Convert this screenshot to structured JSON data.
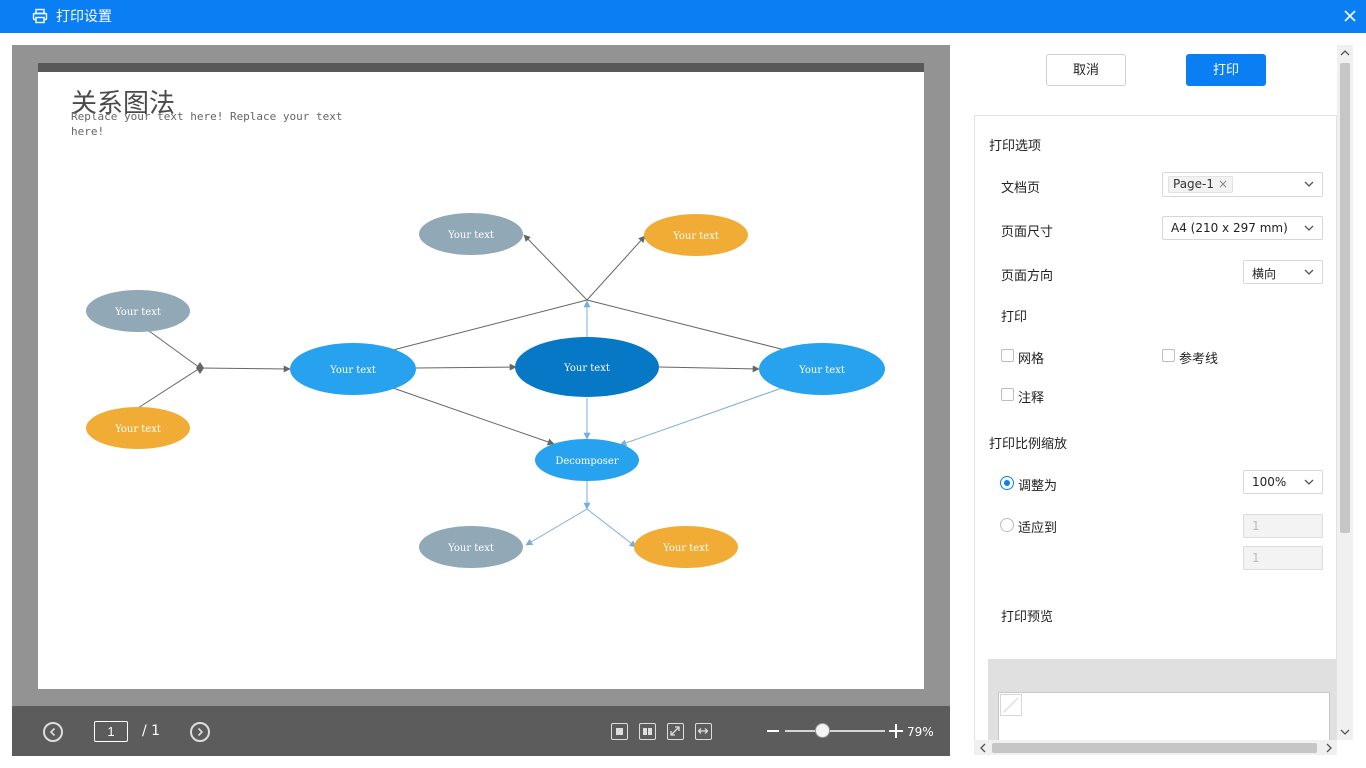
{
  "titlebar": {
    "title": "打印设置",
    "icon": "printer-icon",
    "close_icon": "close-icon",
    "color": "#0a7ff3"
  },
  "document": {
    "title": "关系图法",
    "subtitle": "Replace your text here!  Replace your text here!",
    "nodes": {
      "top_left": "Your text",
      "top_right": "Your text",
      "left_top": "Your text",
      "left_bottom": "Your text",
      "mid_left": "Your text",
      "center": "Your text",
      "mid_right": "Your text",
      "decomposer": "Decomposer",
      "bottom_left": "Your text",
      "bottom_right": "Your text"
    },
    "colors": {
      "gray": "#91a8b7",
      "orange": "#f0ac35",
      "blue": "#27a2ee",
      "center": "#0778c6"
    }
  },
  "bottombar": {
    "prev_icon": "chevron-left-circle-icon",
    "next_icon": "chevron-right-circle-icon",
    "current_page": "1",
    "total_pages": "/ 1",
    "zoom_value": "79%",
    "zoom_level": 0.79,
    "view_icons": [
      "single-page-icon",
      "two-page-icon",
      "fit-page-icon",
      "fit-width-icon"
    ]
  },
  "actions": {
    "cancel_label": "取消",
    "print_label": "打印"
  },
  "options": {
    "section_title": "打印选项",
    "document_pages": {
      "label": "文档页",
      "tag": "Page-1"
    },
    "page_size": {
      "label": "页面尺寸",
      "value": "A4 (210 x 297 mm)"
    },
    "orientation": {
      "label": "页面方向",
      "value": "横向"
    },
    "print_section": "打印",
    "grid": {
      "label": "网格",
      "checked": false
    },
    "guides": {
      "label": "参考线",
      "checked": false
    },
    "notes": {
      "label": "注释",
      "checked": false
    },
    "scale_section": "打印比例缩放",
    "adjust_to": {
      "label": "调整为",
      "selected": true,
      "value": "100%"
    },
    "fit_to": {
      "label": "适应到",
      "selected": false,
      "value_1": "1",
      "value_2": "1"
    },
    "preview_label": "打印预览"
  }
}
